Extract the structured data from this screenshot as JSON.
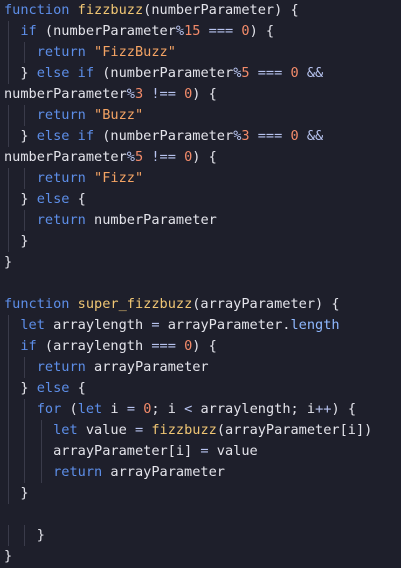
{
  "colors": {
    "background": "#1e1f2b",
    "keyword": "#5d8ee8",
    "function": "#f0c674",
    "string": "#f5a464",
    "number": "#f38b6a",
    "operator": "#b8c4f0",
    "identifier": "#e3e3ea",
    "property": "#8fb8ff",
    "indent_guide": "#3a3b4a"
  },
  "code_lines": [
    [
      {
        "t": "kw",
        "v": "function "
      },
      {
        "t": "fn",
        "v": "fizzbuzz"
      },
      {
        "t": "punct",
        "v": "(numberParameter) {"
      }
    ],
    [
      {
        "t": "punct",
        "v": "  "
      },
      {
        "t": "kw",
        "v": "if"
      },
      {
        "t": "punct",
        "v": " (numberParameter"
      },
      {
        "t": "op",
        "v": "%"
      },
      {
        "t": "num",
        "v": "15"
      },
      {
        "t": "op",
        "v": " === "
      },
      {
        "t": "num",
        "v": "0"
      },
      {
        "t": "punct",
        "v": ") {"
      }
    ],
    [
      {
        "t": "punct",
        "v": "    "
      },
      {
        "t": "kw",
        "v": "return "
      },
      {
        "t": "str",
        "v": "\"FizzBuzz\""
      }
    ],
    [
      {
        "t": "punct",
        "v": "  } "
      },
      {
        "t": "kw",
        "v": "else if"
      },
      {
        "t": "punct",
        "v": " (numberParameter"
      },
      {
        "t": "op",
        "v": "%"
      },
      {
        "t": "num",
        "v": "5"
      },
      {
        "t": "op",
        "v": " === "
      },
      {
        "t": "num",
        "v": "0"
      },
      {
        "t": "op",
        "v": " &&"
      }
    ],
    [
      {
        "t": "punct",
        "v": "numberParameter"
      },
      {
        "t": "op",
        "v": "%"
      },
      {
        "t": "num",
        "v": "3"
      },
      {
        "t": "op",
        "v": " !== "
      },
      {
        "t": "num",
        "v": "0"
      },
      {
        "t": "punct",
        "v": ") {"
      }
    ],
    [
      {
        "t": "punct",
        "v": "    "
      },
      {
        "t": "kw",
        "v": "return "
      },
      {
        "t": "str",
        "v": "\"Buzz\""
      }
    ],
    [
      {
        "t": "punct",
        "v": "  } "
      },
      {
        "t": "kw",
        "v": "else if"
      },
      {
        "t": "punct",
        "v": " (numberParameter"
      },
      {
        "t": "op",
        "v": "%"
      },
      {
        "t": "num",
        "v": "3"
      },
      {
        "t": "op",
        "v": " === "
      },
      {
        "t": "num",
        "v": "0"
      },
      {
        "t": "op",
        "v": " &&"
      }
    ],
    [
      {
        "t": "punct",
        "v": "numberParameter"
      },
      {
        "t": "op",
        "v": "%"
      },
      {
        "t": "num",
        "v": "5"
      },
      {
        "t": "op",
        "v": " !== "
      },
      {
        "t": "num",
        "v": "0"
      },
      {
        "t": "punct",
        "v": ") {"
      }
    ],
    [
      {
        "t": "punct",
        "v": "    "
      },
      {
        "t": "kw",
        "v": "return "
      },
      {
        "t": "str",
        "v": "\"Fizz\""
      }
    ],
    [
      {
        "t": "punct",
        "v": "  } "
      },
      {
        "t": "kw",
        "v": "else"
      },
      {
        "t": "punct",
        "v": " {"
      }
    ],
    [
      {
        "t": "punct",
        "v": "    "
      },
      {
        "t": "kw",
        "v": "return "
      },
      {
        "t": "punct",
        "v": "numberParameter"
      }
    ],
    [
      {
        "t": "punct",
        "v": "  }"
      }
    ],
    [
      {
        "t": "punct",
        "v": "}"
      }
    ],
    [],
    [
      {
        "t": "kw",
        "v": "function "
      },
      {
        "t": "fn",
        "v": "super_fizzbuzz"
      },
      {
        "t": "punct",
        "v": "(arrayParameter) {"
      }
    ],
    [
      {
        "t": "punct",
        "v": "  "
      },
      {
        "t": "kw",
        "v": "let"
      },
      {
        "t": "punct",
        "v": " arraylength "
      },
      {
        "t": "op",
        "v": "="
      },
      {
        "t": "punct",
        "v": " arrayParameter."
      },
      {
        "t": "prop",
        "v": "length"
      }
    ],
    [
      {
        "t": "punct",
        "v": "  "
      },
      {
        "t": "kw",
        "v": "if"
      },
      {
        "t": "punct",
        "v": " (arraylength "
      },
      {
        "t": "op",
        "v": "==="
      },
      {
        "t": "punct",
        "v": " "
      },
      {
        "t": "num",
        "v": "0"
      },
      {
        "t": "punct",
        "v": ") {"
      }
    ],
    [
      {
        "t": "punct",
        "v": "    "
      },
      {
        "t": "kw",
        "v": "return"
      },
      {
        "t": "punct",
        "v": " arrayParameter"
      }
    ],
    [
      {
        "t": "punct",
        "v": "  } "
      },
      {
        "t": "kw",
        "v": "else"
      },
      {
        "t": "punct",
        "v": " {"
      }
    ],
    [
      {
        "t": "punct",
        "v": "    "
      },
      {
        "t": "kw",
        "v": "for"
      },
      {
        "t": "punct",
        "v": " ("
      },
      {
        "t": "kw",
        "v": "let"
      },
      {
        "t": "punct",
        "v": " i "
      },
      {
        "t": "op",
        "v": "="
      },
      {
        "t": "punct",
        "v": " "
      },
      {
        "t": "num",
        "v": "0"
      },
      {
        "t": "punct",
        "v": "; i "
      },
      {
        "t": "op",
        "v": "<"
      },
      {
        "t": "punct",
        "v": " arraylength; i"
      },
      {
        "t": "op",
        "v": "++"
      },
      {
        "t": "punct",
        "v": ") {"
      }
    ],
    [
      {
        "t": "punct",
        "v": "      "
      },
      {
        "t": "kw",
        "v": "let"
      },
      {
        "t": "punct",
        "v": " value "
      },
      {
        "t": "op",
        "v": "="
      },
      {
        "t": "punct",
        "v": " "
      },
      {
        "t": "fn",
        "v": "fizzbuzz"
      },
      {
        "t": "punct",
        "v": "(arrayParameter[i])"
      }
    ],
    [
      {
        "t": "punct",
        "v": "      arrayParameter[i] "
      },
      {
        "t": "op",
        "v": "="
      },
      {
        "t": "punct",
        "v": " value"
      }
    ],
    [
      {
        "t": "punct",
        "v": "      "
      },
      {
        "t": "kw",
        "v": "return"
      },
      {
        "t": "punct",
        "v": " arrayParameter"
      }
    ],
    [
      {
        "t": "punct",
        "v": "  }"
      }
    ],
    [],
    [
      {
        "t": "punct",
        "v": "    }"
      }
    ],
    [
      {
        "t": "punct",
        "v": "}"
      }
    ]
  ]
}
